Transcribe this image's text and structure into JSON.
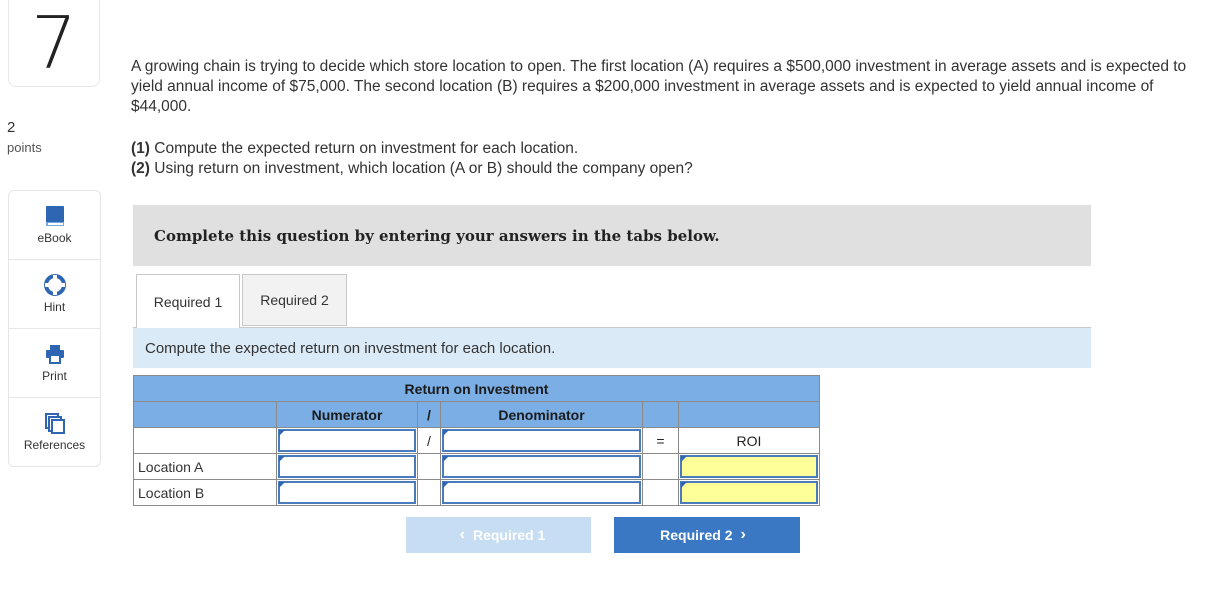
{
  "question": {
    "number": "7",
    "points_value": "2",
    "points_label": "points",
    "prompt": "A growing chain is trying to decide which store location to open. The first location (A) requires a $500,000 investment in average assets and is expected to yield annual income of $75,000. The second location (B) requires a $200,000 investment in average assets and is expected to yield annual income of $44,000.",
    "sub1_label": "(1)",
    "sub1_text": " Compute the expected return on investment for each location.",
    "sub2_label": "(2)",
    "sub2_text": " Using return on investment, which location (A or B) should the company open?"
  },
  "sidebar": {
    "items": [
      {
        "label": "eBook",
        "icon": "book-icon"
      },
      {
        "label": "Hint",
        "icon": "lifebuoy-icon"
      },
      {
        "label": "Print",
        "icon": "printer-icon"
      },
      {
        "label": "References",
        "icon": "documents-icon"
      }
    ]
  },
  "instructions": "Complete this question by entering your answers in the tabs below.",
  "tabs": [
    {
      "label": "Required 1",
      "active": true
    },
    {
      "label": "Required 2",
      "active": false
    }
  ],
  "required_text": "Compute the expected return on investment for each location.",
  "table": {
    "title": "Return on Investment",
    "numerator_header": "Numerator",
    "divide_symbol": "/",
    "denominator_header": "Denominator",
    "equals_symbol": "=",
    "result_header": "ROI",
    "rows": [
      {
        "label": "Location A",
        "numerator": "",
        "denominator": "",
        "roi": ""
      },
      {
        "label": "Location B",
        "numerator": "",
        "denominator": "",
        "roi": ""
      }
    ]
  },
  "nav": {
    "prev_label": "Required 1",
    "next_label": "Required 2"
  },
  "colors": {
    "header_blue": "#7aaee5",
    "answer_yellow": "#ffff99",
    "next_button": "#3b78c3",
    "prev_button_disabled": "#c6ddf3",
    "required_bar": "#dbeaf7"
  }
}
